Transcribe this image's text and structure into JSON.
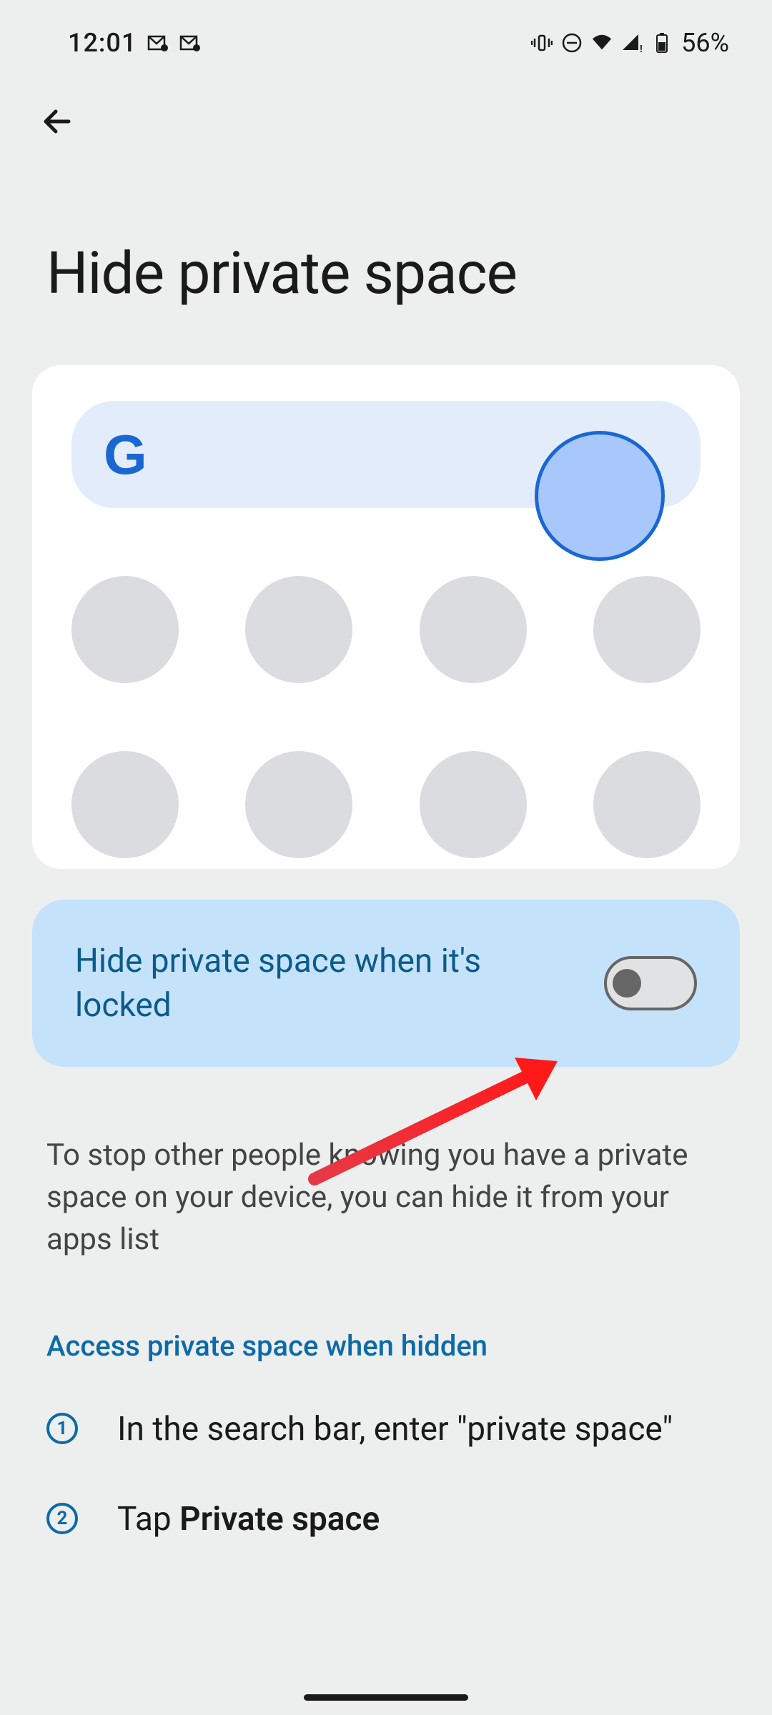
{
  "status_bar": {
    "time": "12:01",
    "battery_pct": "56%"
  },
  "page_title": "Hide private space",
  "toggle": {
    "label": "Hide private space when it's locked",
    "enabled": false
  },
  "description": "To stop other people knowing you have a private space on your device, you can hide it from your apps list",
  "section_header": "Access private space when hidden",
  "steps": [
    {
      "number": "1",
      "text_pre": "In the search bar, enter \"private space\"",
      "bold": ""
    },
    {
      "number": "2",
      "text_pre": "Tap ",
      "bold": "Private space"
    }
  ]
}
